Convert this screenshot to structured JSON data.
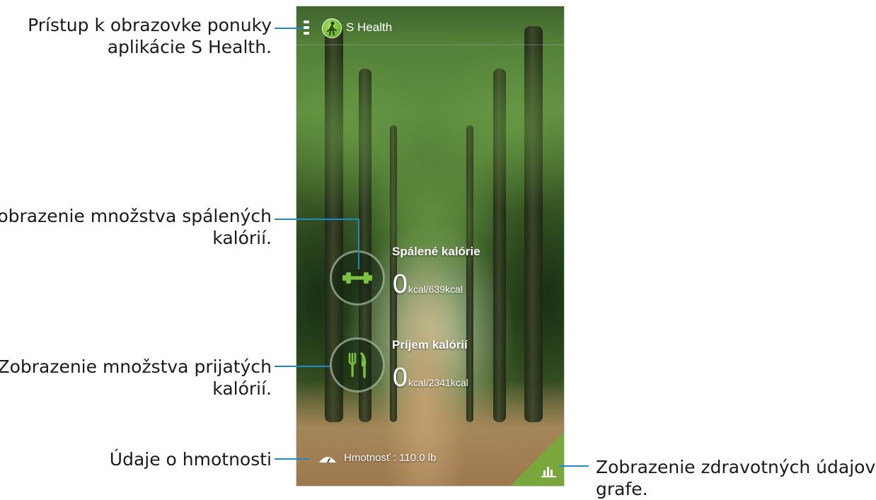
{
  "app": {
    "title": "S Health"
  },
  "cards": {
    "burned": {
      "title": "Spálené kalórie",
      "value": "0",
      "unit": "kcal/639kcal",
      "icon": "dumbbell-icon"
    },
    "intake": {
      "title": "Príjem kalórií",
      "value": "0",
      "unit": "kcal/2341kcal",
      "icon": "fork-knife-icon"
    }
  },
  "weight": {
    "label": "Hmotnosť : 110.0 lb",
    "icon": "scale-icon"
  },
  "graph_button": {
    "icon": "bar-chart-icon"
  },
  "callouts": {
    "menu": [
      "Prístup k obrazovke ponuky",
      "aplikácie S Health."
    ],
    "burned": [
      "Zobrazenie množstva spálených",
      "kalórií."
    ],
    "intake": [
      "Zobrazenie množstva prijatých",
      "kalórií."
    ],
    "weight": [
      "Údaje o hmotnosti"
    ],
    "graph": [
      "Zobrazenie zdravotných údajov na",
      "grafe."
    ]
  },
  "colors": {
    "accent_green": "#7aa73c",
    "leader_blue": "#1f8ac9",
    "icon_green": "#7cc242"
  }
}
